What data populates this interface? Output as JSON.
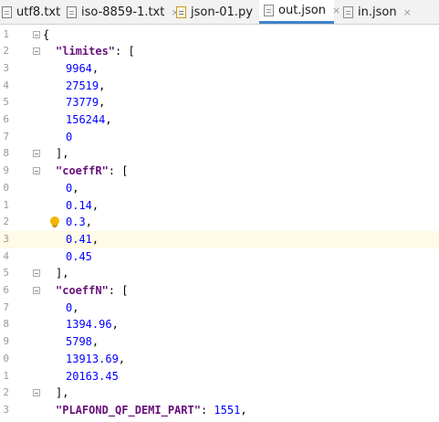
{
  "tabs": [
    {
      "label": "utf8.txt",
      "icon": "text-file-icon",
      "active": false
    },
    {
      "label": "iso-8859-1.txt",
      "icon": "text-file-icon",
      "active": false
    },
    {
      "label": "json-01.py",
      "icon": "python-file-icon",
      "active": false
    },
    {
      "label": "out.json",
      "icon": "json-file-icon",
      "active": true
    },
    {
      "label": "in.json",
      "icon": "json-file-icon",
      "active": false
    }
  ],
  "tab_close_glyph": "×",
  "editor": {
    "current_line": 13,
    "lines": [
      {
        "n": "1",
        "text": "{"
      },
      {
        "n": "2",
        "key": "\"limites\"",
        "text": ": ["
      },
      {
        "n": "3",
        "num": "9964",
        "text": ","
      },
      {
        "n": "4",
        "num": "27519",
        "text": ","
      },
      {
        "n": "5",
        "num": "73779",
        "text": ","
      },
      {
        "n": "6",
        "num": "156244",
        "text": ","
      },
      {
        "n": "7",
        "num": "0",
        "text": ""
      },
      {
        "n": "8",
        "text": "],"
      },
      {
        "n": "9",
        "key": "\"coeffR\"",
        "text": ": ["
      },
      {
        "n": "0",
        "num": "0",
        "text": ","
      },
      {
        "n": "1",
        "num": "0.14",
        "text": ","
      },
      {
        "n": "2",
        "num": "0.3",
        "text": ","
      },
      {
        "n": "3",
        "num": "0.41",
        "text": ","
      },
      {
        "n": "4",
        "num": "0.45",
        "text": ""
      },
      {
        "n": "5",
        "text": "],"
      },
      {
        "n": "6",
        "key": "\"coeffN\"",
        "text": ": ["
      },
      {
        "n": "7",
        "num": "0",
        "text": ","
      },
      {
        "n": "8",
        "num": "1394.96",
        "text": ","
      },
      {
        "n": "9",
        "num": "5798",
        "text": ","
      },
      {
        "n": "0",
        "num": "13913.69",
        "text": ","
      },
      {
        "n": "1",
        "num": "20163.45",
        "text": ""
      },
      {
        "n": "2",
        "text": "],"
      },
      {
        "n": "3",
        "key": "\"PLAFOND_QF_DEMI_PART\"",
        "text": ": ",
        "num2": "1551",
        "text2": ","
      }
    ]
  },
  "colors": {
    "key": "#660e7a",
    "number": "#0000ff",
    "active_tab_underline": "#4083c9",
    "current_line": "#fffbe6"
  }
}
